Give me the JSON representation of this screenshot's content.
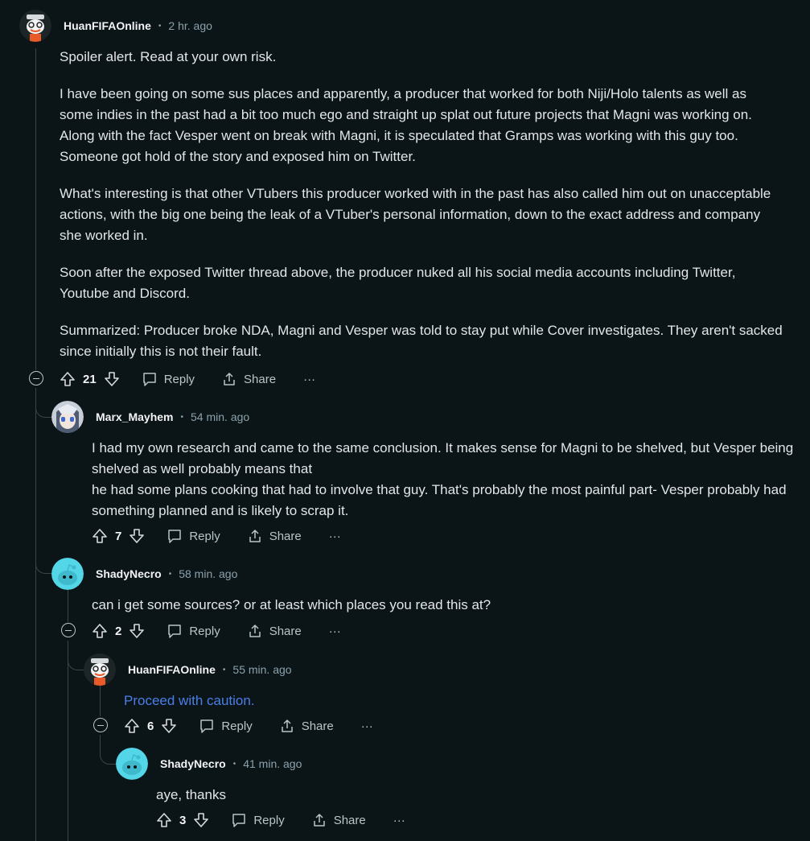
{
  "comments": [
    {
      "author": "HuanFIFAOnline",
      "time": "2 hr. ago",
      "paragraphs": [
        "Spoiler alert. Read at your own risk.",
        "I have been going on some sus places and apparently, a producer that worked for both Niji/Holo talents as well as some indies in the past had a bit too much ego and straight up splat out future projects that Magni was working on. Along with the fact Vesper went on break with Magni, it is speculated that Gramps was working with this guy too. Someone got hold of the story and exposed him on Twitter.",
        "What's interesting is that other VTubers this producer worked with in the past has also called him out on unacceptable actions, with the big one being the leak of a VTuber's personal information, down to the exact address and company she worked in.",
        "Soon after the exposed Twitter thread above, the producer nuked all his social media accounts including Twitter, Youtube and Discord.",
        "Summarized: Producer broke NDA, Magni and Vesper was told to stay put while Cover investigates. They aren't sacked since initially this is not their fault."
      ],
      "votes": "21"
    },
    {
      "author": "Marx_Mayhem",
      "time": "54 min. ago",
      "lines": [
        "I had my own research and came to the same conclusion. It makes sense for Magni to be shelved, but Vesper being shelved as well probably means that",
        "he had some plans cooking that had to involve that guy. That's probably the most painful part- Vesper probably had something planned and is likely to scrap it."
      ],
      "votes": "7"
    },
    {
      "author": "ShadyNecro",
      "time": "58 min. ago",
      "text": "can i get some sources? or at least which places you read this at?",
      "votes": "2"
    },
    {
      "author": "HuanFIFAOnline",
      "time": "55 min. ago",
      "link_text": "Proceed with caution.",
      "votes": "6"
    },
    {
      "author": "ShadyNecro",
      "time": "41 min. ago",
      "text": "aye, thanks",
      "votes": "3"
    }
  ],
  "actions": {
    "reply": "Reply",
    "share": "Share",
    "more": "···"
  },
  "colors": {
    "background": "#0b1416",
    "link": "#4a7fe8",
    "thread_line": "#3a4449",
    "snoo": "#52d6e8"
  }
}
